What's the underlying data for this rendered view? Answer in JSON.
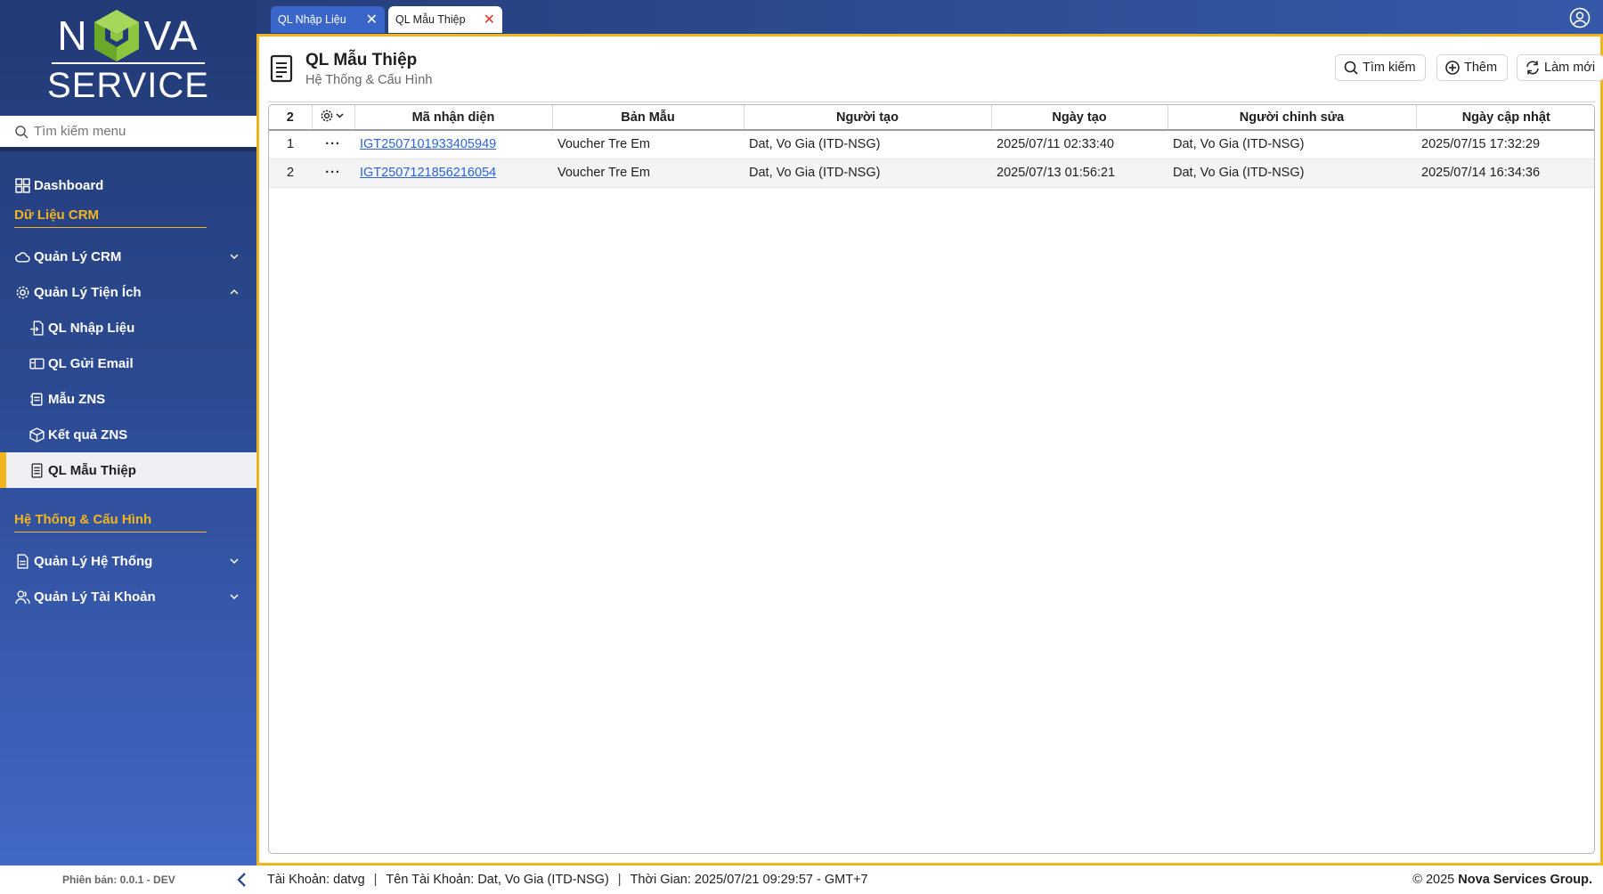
{
  "brand": {
    "logo_top_left": "N",
    "logo_top_right": "VA",
    "logo_bottom": "SERVICE"
  },
  "sidebar": {
    "search_placeholder": "Tìm kiếm menu",
    "dashboard": "Dashboard",
    "section_crm": "Dữ Liệu CRM",
    "crm_manage": "Quản Lý CRM",
    "utilities": "Quản Lý Tiện Ích",
    "sub_items": [
      {
        "label": "QL Nhập Liệu",
        "icon": "import-icon"
      },
      {
        "label": "QL Gửi Email",
        "icon": "email-icon"
      },
      {
        "label": "Mẫu ZNS",
        "icon": "template-icon"
      },
      {
        "label": "Kết quả ZNS",
        "icon": "cube-icon"
      },
      {
        "label": "QL Mẫu Thiệp",
        "icon": "document-icon"
      }
    ],
    "section_system": "Hệ Thống & Cấu Hình",
    "system_manage": "Quản Lý Hệ Thống",
    "account_manage": "Quản Lý Tài Khoản"
  },
  "tabs": [
    {
      "label": "QL Nhập Liệu"
    },
    {
      "label": "QL Mẫu Thiệp"
    }
  ],
  "page": {
    "title": "QL Mẫu Thiệp",
    "subtitle": "Hệ Thống & Cấu Hình",
    "btn_search": "Tìm kiếm",
    "btn_add": "Thêm",
    "btn_refresh": "Làm mới"
  },
  "table": {
    "count": "2",
    "columns": [
      "Mã nhận diện",
      "Bản Mẫu",
      "Người tạo",
      "Ngày tạo",
      "Người chỉnh sửa",
      "Ngày cập nhật"
    ],
    "rows": [
      {
        "no": "1",
        "dots": "···",
        "code": "IGT2507101933405949",
        "template": "Voucher Tre Em",
        "creator": "Dat, Vo Gia (ITD-NSG)",
        "created": "2025/07/11 02:33:40",
        "editor": "Dat, Vo Gia (ITD-NSG)",
        "updated": "2025/07/15 17:32:29"
      },
      {
        "no": "2",
        "dots": "···",
        "code": "IGT2507121856216054",
        "template": "Voucher Tre Em",
        "creator": "Dat, Vo Gia (ITD-NSG)",
        "created": "2025/07/13 01:56:21",
        "editor": "Dat, Vo Gia (ITD-NSG)",
        "updated": "2025/07/14 16:34:36"
      }
    ]
  },
  "footer": {
    "version": "Phiên bản: 0.0.1 - DEV",
    "account": "Tài Khoản: datvg",
    "account_name": "Tên Tài Khoản: Dat, Vo Gia (ITD-NSG)",
    "time": "Thời Gian: 2025/07/21 09:29:57 - GMT+7",
    "copyright_prefix": "© 2025",
    "copyright_brand": "Nova Services Group."
  },
  "colors": {
    "accent": "#f2b51d",
    "sidebar": "#2c4a92",
    "link": "#2d62d8",
    "close": "#e0312a"
  }
}
